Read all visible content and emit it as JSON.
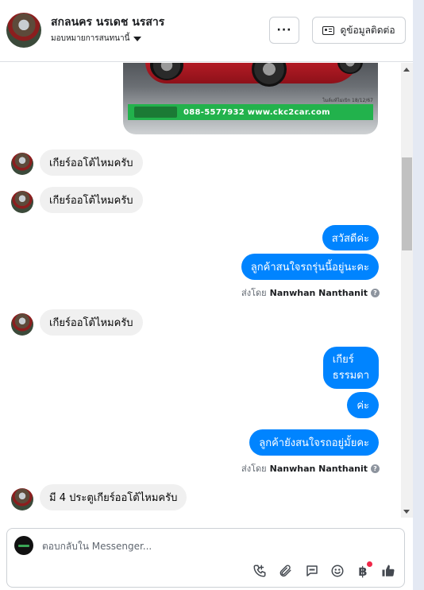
{
  "header": {
    "contact_name": "สกลนคร นรเดช นรสาร",
    "assign_label": "มอบหมายการสนทนานี้",
    "more_label": "···",
    "contact_info_label": "ดูข้อมูลติดต่อ"
  },
  "attachment": {
    "banner_phone_site": "088-5577932 www.ckc2car.com",
    "date_stamp": "ไมล์แท้ไม่เบิก 18/12/67"
  },
  "messages": [
    {
      "direction": "in",
      "text": "เกียร์ออโต้ไหมครับ"
    },
    {
      "direction": "in",
      "text": "เกียร์ออโต้ไหมครับ"
    },
    {
      "direction": "out",
      "text": "สวัสดีค่ะ"
    },
    {
      "direction": "out",
      "text": "ลูกค้าสนใจรถรุ่นนี้อยู่นะคะ"
    },
    {
      "direction": "meta",
      "prefix": "ส่งโดย",
      "sender": "Nanwhan Nanthanit"
    },
    {
      "direction": "in",
      "text": "เกียร์ออโต้ไหมครับ"
    },
    {
      "direction": "out",
      "text_line1": "เกียร์",
      "text_line2": "ธรรมดา"
    },
    {
      "direction": "out",
      "text": "ค่ะ"
    },
    {
      "direction": "out",
      "text": "ลูกค้ายังสนใจรถอยู่มั้ยคะ"
    },
    {
      "direction": "meta",
      "prefix": "ส่งโดย",
      "sender": "Nanwhan Nanthanit"
    },
    {
      "direction": "in",
      "text": "มี 4 ประตูเกียร์ออโต้ไหมครับ"
    }
  ],
  "composer": {
    "placeholder": "ตอบกลับใน Messenger...",
    "tools": [
      "call-icon",
      "attachment-icon",
      "saved-reply-icon",
      "emoji-icon",
      "payment-icon",
      "like-icon"
    ]
  },
  "colors": {
    "outgoing_bubble": "#0084ff",
    "incoming_bubble": "#f0f0f0",
    "notification_dot": "#f02849"
  }
}
